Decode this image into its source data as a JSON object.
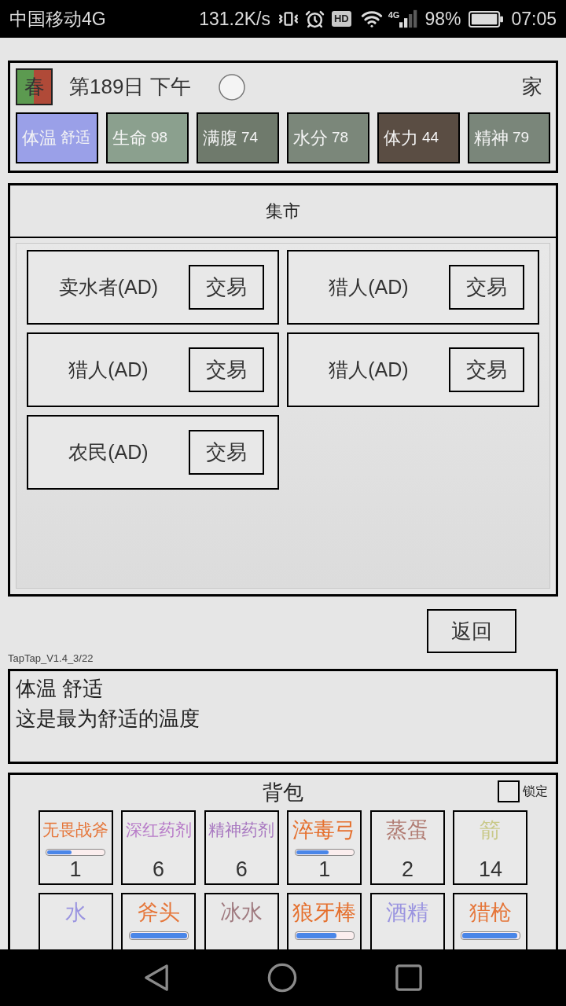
{
  "status_bar": {
    "carrier": "中国移动4G",
    "speed": "131.2K/s",
    "hd": "HD",
    "network": "4G",
    "battery": "98%",
    "time": "07:05"
  },
  "header": {
    "season": "春",
    "day": "第189日 下午",
    "location": "家"
  },
  "stats": [
    {
      "label": "体温",
      "value": "舒适",
      "color": "#9aa0e8"
    },
    {
      "label": "生命",
      "value": "98",
      "color": "#8ba08e"
    },
    {
      "label": "满腹",
      "value": "74",
      "color": "#6f7a6c"
    },
    {
      "label": "水分",
      "value": "78",
      "color": "#7b877a"
    },
    {
      "label": "体力",
      "value": "44",
      "color": "#5a4d43"
    },
    {
      "label": "精神",
      "value": "79",
      "color": "#7a867a"
    }
  ],
  "market": {
    "title": "集市",
    "traders": [
      {
        "name": "卖水者(AD)",
        "action": "交易"
      },
      {
        "name": "猎人(AD)",
        "action": "交易"
      },
      {
        "name": "猎人(AD)",
        "action": "交易"
      },
      {
        "name": "猎人(AD)",
        "action": "交易"
      },
      {
        "name": "农民(AD)",
        "action": "交易"
      }
    ]
  },
  "back_button": "返回",
  "version": "TapTap_V1.4_3/22",
  "info": {
    "title": "体温 舒适",
    "description": "这是最为舒适的温度"
  },
  "backpack": {
    "title": "背包",
    "lock": {
      "label": "锁定",
      "checked": false
    },
    "items": [
      {
        "name": "无畏战斧",
        "color": "#e5763a",
        "level": 0.43,
        "count": "1"
      },
      {
        "name": "深红药剂",
        "color": "#b77ac8",
        "count": "6"
      },
      {
        "name": "精神药剂",
        "color": "#a878c0",
        "count": "6"
      },
      {
        "name": "淬毒弓",
        "color": "#e5702e",
        "level": 0.57,
        "count": "1"
      },
      {
        "name": "蒸蛋",
        "color": "#b07b72",
        "count": "2"
      },
      {
        "name": "箭",
        "color": "#c9c98a",
        "count": "14"
      },
      {
        "name": "水",
        "color": "#9a94e0"
      },
      {
        "name": "斧头",
        "color": "#e5763a",
        "level": 1
      },
      {
        "name": "冰水",
        "color": "#a07b80"
      },
      {
        "name": "狼牙棒",
        "color": "#e5702e",
        "level": 0.71
      },
      {
        "name": "酒精",
        "color": "#9a94e0"
      },
      {
        "name": "猎枪",
        "color": "#e5763a",
        "level": 0.97
      }
    ]
  }
}
